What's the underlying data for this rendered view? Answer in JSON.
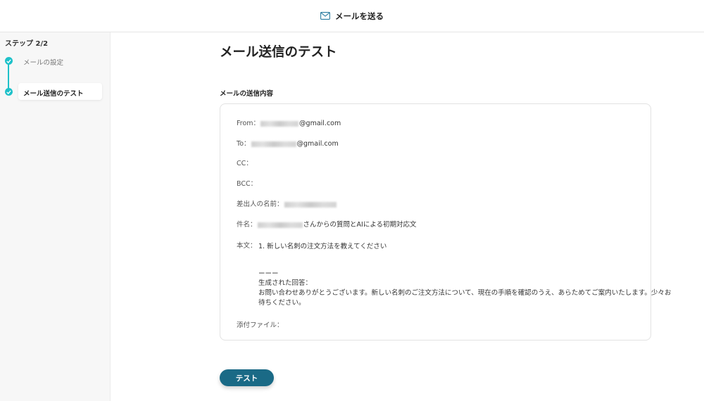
{
  "header": {
    "title": "メールを送る",
    "icon": "mail-icon"
  },
  "sidebar": {
    "step_count": "ステップ 2/2",
    "steps": [
      {
        "label": "メールの設定",
        "status": "done"
      },
      {
        "label": "メール送信のテスト",
        "status": "current"
      }
    ]
  },
  "main": {
    "title": "メール送信のテスト",
    "section_label": "メールの送信内容",
    "fields": {
      "from_label": "From：",
      "from_suffix": "@gmail.com",
      "to_label": "To：",
      "to_suffix": "@gmail.com",
      "cc_label": "CC：",
      "bcc_label": "BCC：",
      "sender_label": "差出人の名前：",
      "subject_label": "件名：",
      "subject_suffix": "さんからの質問とAIによる初期対応文",
      "body_label": "本文：",
      "body_line1": "1. 新しい名刺の注文方法を教えてください",
      "body_line2": "ーーー",
      "body_line3": "生成された回答：",
      "body_line4": "お問い合わせありがとうございます。新しい名刺のご注文方法について、現在の手順を確認のうえ、あらためてご案内いたします。少々お",
      "body_line5": "待ちください。",
      "attachment_label": "添付ファイル："
    },
    "test_button": "テスト"
  },
  "colors": {
    "accent": "#1ec1c9",
    "button": "#1a6a86"
  }
}
